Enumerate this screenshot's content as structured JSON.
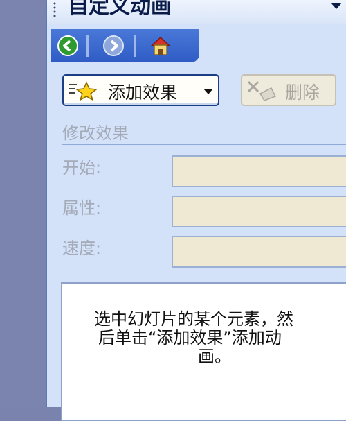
{
  "panel": {
    "title": "自定义动画"
  },
  "nav": {
    "back_icon": "back-arrow-icon",
    "forward_icon": "forward-arrow-icon",
    "home_icon": "home-icon"
  },
  "toolbar": {
    "add_effect_label": "添加效果",
    "delete_label": "删除"
  },
  "modify_group": {
    "title": "修改效果",
    "start_label": "开始:",
    "property_label": "属性:",
    "speed_label": "速度:",
    "start_value": "",
    "property_value": "",
    "speed_value": ""
  },
  "effects_list": {
    "hint_line1": "选中幻灯片的某个元素，然",
    "hint_line2": "后单击“添加效果”添加动",
    "hint_line3": "画。"
  },
  "colors": {
    "pane_bg": "#d3e1f9",
    "nav_blue": "#3a68cf",
    "disabled_field": "#efe8d2"
  }
}
